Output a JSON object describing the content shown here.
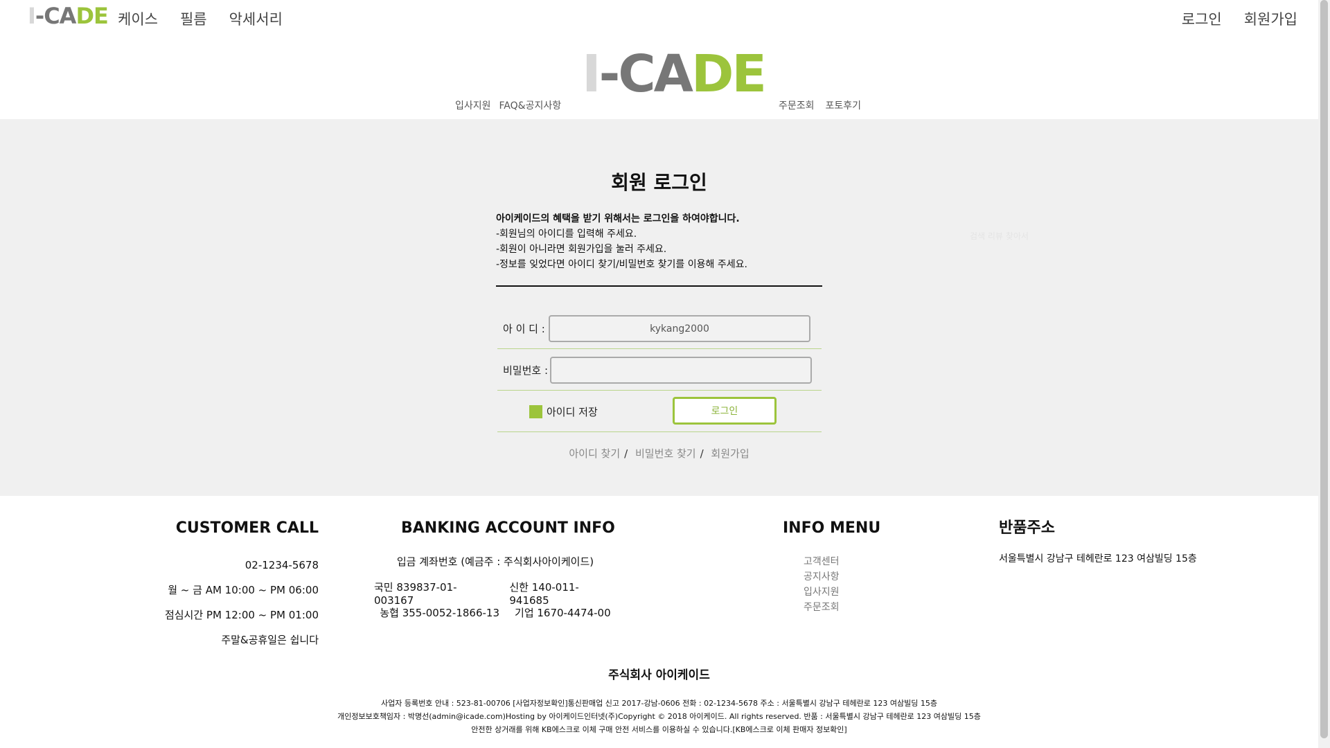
{
  "brand": {
    "logo_i": "I",
    "logo_dash": "-",
    "logo_ca": "CA",
    "logo_de": "DE",
    "accent_color": "#9cc43c",
    "grey_color": "#777777"
  },
  "header": {
    "main_nav": [
      "케이스",
      "필름",
      "악세서리"
    ],
    "auth_nav": {
      "login": "로그인",
      "signup": "회원가입"
    },
    "sub_nav_left": [
      "입사지원",
      "FAQ&공지사항"
    ],
    "sub_nav_right": [
      "주문조회",
      "포토후기"
    ]
  },
  "login": {
    "title": "회원 로그인",
    "ghost_text": "검색 리뷰 찾아서",
    "notice": [
      "아이케이드의 혜택을 받기 위해서는 로그인을 하여야합니다.",
      "-회원님의 아이디를 입력해 주세요.",
      "-회원이 아니라면 회원가입을 눌러 주세요.",
      "-정보를 잊었다면 아이디 찾기/비밀번호 찾기를 이용해 주세요."
    ],
    "id_label": "아 이 디 :",
    "id_value": "kykang2000",
    "pw_label": "비밀번호 :",
    "pw_value": "",
    "save_id_label": "아이디 저장",
    "save_id_checked": true,
    "login_button": "로그인",
    "find_id": "아이디 찾기",
    "find_pw": "비밀번호 찾기",
    "signup": "회원가입",
    "separator": "/"
  },
  "footer": {
    "customer_call": {
      "title": "CUSTOMER CALL",
      "lines": [
        "02-1234-5678",
        "월 ~ 금 AM 10:00 ~ PM 06:00",
        "점심시간 PM 12:00 ~ PM 01:00",
        "주말&공휴일은 쉽니다"
      ]
    },
    "banking": {
      "title": "BANKING ACCOUNT INFO",
      "holder": "입금 계좌번호 (예금주 : 주식회사아이케이드)",
      "accounts": [
        [
          "국민 839837-01-003167",
          "신한 140-011-941685"
        ],
        [
          "농협 355-0052-1866-13",
          "기업 1670-4474-00"
        ]
      ]
    },
    "info_menu": {
      "title": "INFO MENU",
      "items": [
        "고객센터",
        "공지사항",
        "입사지원",
        "주문조회"
      ]
    },
    "return_address": {
      "title": "반품주소",
      "address": "서울특별시 강남구 테헤란로 123 여삼빌딩 15층"
    },
    "company_name": "주식회사 아이케이드",
    "legal_lines": [
      "사업자 등록번호 안내 : 523-81-00706 [사업자정보확인]통신판매업 신고 2017-강남-0606 전화 : 02-1234-5678 주소 : 서울특별시 강남구 테헤란로 123 여삼빌딩 15층",
      "개인정보보호책임자 : 박명선(admin@icade.com)Hosting by 아이케이드인터넷(주)Copyright © 2018 아이케이드. All rights reserved. 반품 : 서울특별시 강남구 테헤란로 123 여삼빌딩 15층",
      "안전한 상거래를 위해 KB에스크로 이체 구매 안전 서비스를 이용하실 수 있습니다.[KB에스크로 이체 판매자 정보확인]"
    ]
  }
}
